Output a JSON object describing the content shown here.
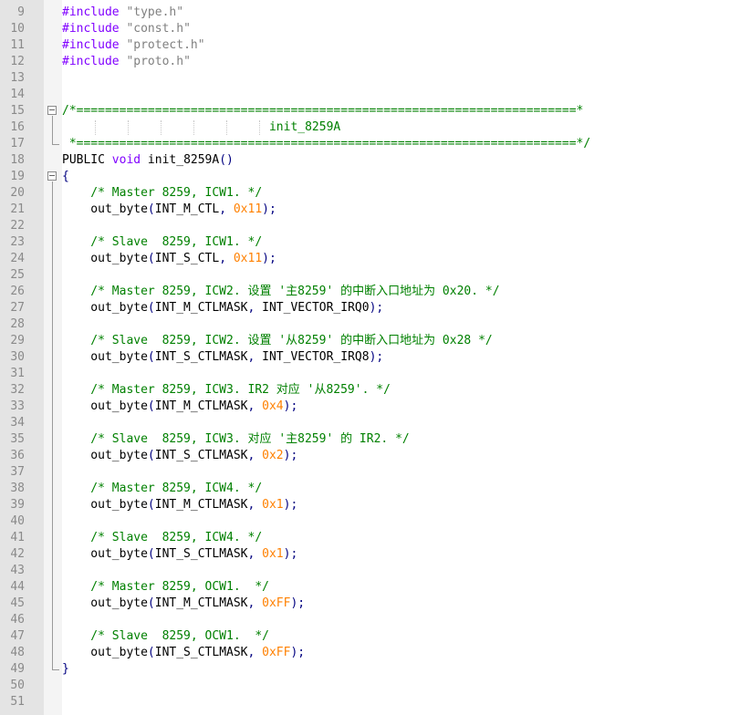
{
  "editor": {
    "lines": [
      {
        "n": "9",
        "parts": [
          {
            "t": "#include ",
            "c": "kw"
          },
          {
            "t": "\"type.h\"",
            "c": "str"
          }
        ]
      },
      {
        "n": "10",
        "parts": [
          {
            "t": "#include ",
            "c": "kw"
          },
          {
            "t": "\"const.h\"",
            "c": "str"
          }
        ]
      },
      {
        "n": "11",
        "parts": [
          {
            "t": "#include ",
            "c": "kw"
          },
          {
            "t": "\"protect.h\"",
            "c": "str"
          }
        ]
      },
      {
        "n": "12",
        "parts": [
          {
            "t": "#include ",
            "c": "kw"
          },
          {
            "t": "\"proto.h\"",
            "c": "str"
          }
        ]
      },
      {
        "n": "13",
        "parts": []
      },
      {
        "n": "14",
        "parts": []
      },
      {
        "n": "15",
        "fold": "open",
        "parts": [
          {
            "t": "/*======================================================================*",
            "c": "cm"
          }
        ]
      },
      {
        "n": "16",
        "parts": [
          {
            "t": "                             init_8259A",
            "c": "cm"
          }
        ]
      },
      {
        "n": "17",
        "parts": [
          {
            "t": " *======================================================================*/",
            "c": "cm"
          }
        ]
      },
      {
        "n": "18",
        "parts": [
          {
            "t": "PUBLIC ",
            "c": "tx"
          },
          {
            "t": "void",
            "c": "kw"
          },
          {
            "t": " init_8259A",
            "c": "tx"
          },
          {
            "t": "()",
            "c": "op"
          }
        ]
      },
      {
        "n": "19",
        "fold": "open",
        "parts": [
          {
            "t": "{",
            "c": "op"
          }
        ]
      },
      {
        "n": "20",
        "parts": [
          {
            "t": "    /* Master 8259, ICW1. */",
            "c": "cm"
          }
        ]
      },
      {
        "n": "21",
        "parts": [
          {
            "t": "    out_byte",
            "c": "tx"
          },
          {
            "t": "(",
            "c": "op"
          },
          {
            "t": "INT_M_CTL",
            "c": "tx"
          },
          {
            "t": ", ",
            "c": "op"
          },
          {
            "t": "0x11",
            "c": "num"
          },
          {
            "t": ");",
            "c": "op"
          }
        ]
      },
      {
        "n": "22",
        "parts": []
      },
      {
        "n": "23",
        "parts": [
          {
            "t": "    /* Slave  8259, ICW1. */",
            "c": "cm"
          }
        ]
      },
      {
        "n": "24",
        "parts": [
          {
            "t": "    out_byte",
            "c": "tx"
          },
          {
            "t": "(",
            "c": "op"
          },
          {
            "t": "INT_S_CTL",
            "c": "tx"
          },
          {
            "t": ", ",
            "c": "op"
          },
          {
            "t": "0x11",
            "c": "num"
          },
          {
            "t": ");",
            "c": "op"
          }
        ]
      },
      {
        "n": "25",
        "parts": []
      },
      {
        "n": "26",
        "parts": [
          {
            "t": "    /* Master 8259, ICW2. 设置 '主8259' 的中断入口地址为 0x20. */",
            "c": "cm"
          }
        ]
      },
      {
        "n": "27",
        "parts": [
          {
            "t": "    out_byte",
            "c": "tx"
          },
          {
            "t": "(",
            "c": "op"
          },
          {
            "t": "INT_M_CTLMASK",
            "c": "tx"
          },
          {
            "t": ", ",
            "c": "op"
          },
          {
            "t": "INT_VECTOR_IRQ0",
            "c": "tx"
          },
          {
            "t": ");",
            "c": "op"
          }
        ]
      },
      {
        "n": "28",
        "parts": []
      },
      {
        "n": "29",
        "parts": [
          {
            "t": "    /* Slave  8259, ICW2. 设置 '从8259' 的中断入口地址为 0x28 */",
            "c": "cm"
          }
        ]
      },
      {
        "n": "30",
        "parts": [
          {
            "t": "    out_byte",
            "c": "tx"
          },
          {
            "t": "(",
            "c": "op"
          },
          {
            "t": "INT_S_CTLMASK",
            "c": "tx"
          },
          {
            "t": ", ",
            "c": "op"
          },
          {
            "t": "INT_VECTOR_IRQ8",
            "c": "tx"
          },
          {
            "t": ");",
            "c": "op"
          }
        ]
      },
      {
        "n": "31",
        "parts": []
      },
      {
        "n": "32",
        "parts": [
          {
            "t": "    /* Master 8259, ICW3. IR2 对应 '从8259'. */",
            "c": "cm"
          }
        ]
      },
      {
        "n": "33",
        "parts": [
          {
            "t": "    out_byte",
            "c": "tx"
          },
          {
            "t": "(",
            "c": "op"
          },
          {
            "t": "INT_M_CTLMASK",
            "c": "tx"
          },
          {
            "t": ", ",
            "c": "op"
          },
          {
            "t": "0x4",
            "c": "num"
          },
          {
            "t": ");",
            "c": "op"
          }
        ]
      },
      {
        "n": "34",
        "parts": []
      },
      {
        "n": "35",
        "parts": [
          {
            "t": "    /* Slave  8259, ICW3. 对应 '主8259' 的 IR2. */",
            "c": "cm"
          }
        ]
      },
      {
        "n": "36",
        "parts": [
          {
            "t": "    out_byte",
            "c": "tx"
          },
          {
            "t": "(",
            "c": "op"
          },
          {
            "t": "INT_S_CTLMASK",
            "c": "tx"
          },
          {
            "t": ", ",
            "c": "op"
          },
          {
            "t": "0x2",
            "c": "num"
          },
          {
            "t": ");",
            "c": "op"
          }
        ]
      },
      {
        "n": "37",
        "parts": []
      },
      {
        "n": "38",
        "parts": [
          {
            "t": "    /* Master 8259, ICW4. */",
            "c": "cm"
          }
        ]
      },
      {
        "n": "39",
        "parts": [
          {
            "t": "    out_byte",
            "c": "tx"
          },
          {
            "t": "(",
            "c": "op"
          },
          {
            "t": "INT_M_CTLMASK",
            "c": "tx"
          },
          {
            "t": ", ",
            "c": "op"
          },
          {
            "t": "0x1",
            "c": "num"
          },
          {
            "t": ");",
            "c": "op"
          }
        ]
      },
      {
        "n": "40",
        "parts": []
      },
      {
        "n": "41",
        "parts": [
          {
            "t": "    /* Slave  8259, ICW4. */",
            "c": "cm"
          }
        ]
      },
      {
        "n": "42",
        "parts": [
          {
            "t": "    out_byte",
            "c": "tx"
          },
          {
            "t": "(",
            "c": "op"
          },
          {
            "t": "INT_S_CTLMASK",
            "c": "tx"
          },
          {
            "t": ", ",
            "c": "op"
          },
          {
            "t": "0x1",
            "c": "num"
          },
          {
            "t": ");",
            "c": "op"
          }
        ]
      },
      {
        "n": "43",
        "parts": []
      },
      {
        "n": "44",
        "parts": [
          {
            "t": "    /* Master 8259, OCW1.  */",
            "c": "cm"
          }
        ]
      },
      {
        "n": "45",
        "parts": [
          {
            "t": "    out_byte",
            "c": "tx"
          },
          {
            "t": "(",
            "c": "op"
          },
          {
            "t": "INT_M_CTLMASK",
            "c": "tx"
          },
          {
            "t": ", ",
            "c": "op"
          },
          {
            "t": "0xFF",
            "c": "num"
          },
          {
            "t": ");",
            "c": "op"
          }
        ]
      },
      {
        "n": "46",
        "parts": []
      },
      {
        "n": "47",
        "parts": [
          {
            "t": "    /* Slave  8259, OCW1.  */",
            "c": "cm"
          }
        ]
      },
      {
        "n": "48",
        "parts": [
          {
            "t": "    out_byte",
            "c": "tx"
          },
          {
            "t": "(",
            "c": "op"
          },
          {
            "t": "INT_S_CTLMASK",
            "c": "tx"
          },
          {
            "t": ", ",
            "c": "op"
          },
          {
            "t": "0xFF",
            "c": "num"
          },
          {
            "t": ");",
            "c": "op"
          }
        ]
      },
      {
        "n": "49",
        "fold": "end",
        "parts": [
          {
            "t": "}",
            "c": "op"
          }
        ]
      },
      {
        "n": "50",
        "parts": []
      },
      {
        "n": "51",
        "parts": []
      }
    ]
  }
}
